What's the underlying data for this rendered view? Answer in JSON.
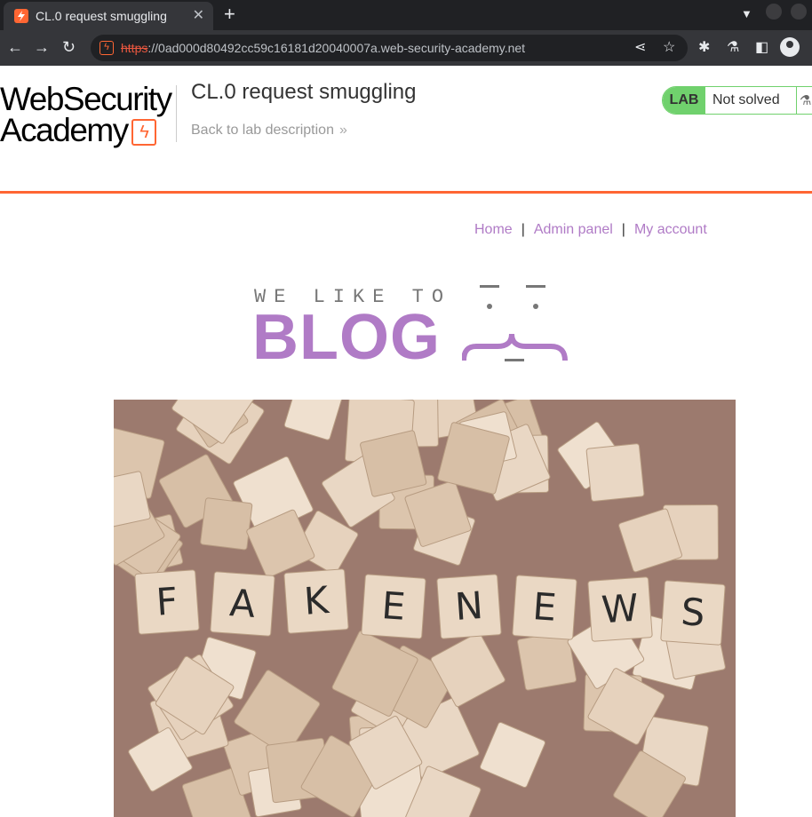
{
  "browser": {
    "tab_title": "CL.0 request smuggling",
    "url_scheme": "https",
    "url_rest": "://0ad000d80492cc59c16181d20040007a.web-security-academy.net"
  },
  "academy": {
    "logo_line1": "WebSecurity",
    "logo_line2": "Academy",
    "lab_title": "CL.0 request smuggling",
    "back_link": "Back to lab description",
    "status_tag": "LAB",
    "status_text": "Not solved"
  },
  "nav": {
    "home": "Home",
    "admin": "Admin panel",
    "account": "My account",
    "separator": "|"
  },
  "banner": {
    "tagline": "WE LIKE TO",
    "title": "BLOG"
  },
  "hero": {
    "tiles": [
      "F",
      "A",
      "K",
      "E",
      "N",
      "E",
      "W",
      "S"
    ]
  },
  "colors": {
    "accent": "#ff6633",
    "link": "#b07bc6",
    "lab_green": "#70d16d"
  }
}
